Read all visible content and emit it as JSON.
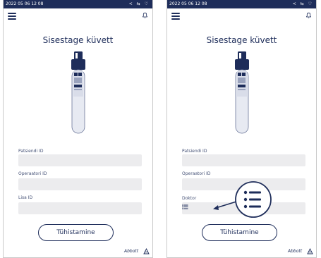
{
  "screens": [
    {
      "status_time": "2022 05 06 12 08",
      "status_icons": "< ⇆ ♡",
      "title": "Sisestage küvett",
      "fields": [
        {
          "label": "Patsiendi ID",
          "value": ""
        },
        {
          "label": "Operaatori ID",
          "value": ""
        },
        {
          "label": "Lisa ID",
          "value": ""
        }
      ],
      "cancel_label": "Tühistamine",
      "logo_text": "Abbott"
    },
    {
      "status_time": "2022 05 06 12 08",
      "status_icons": "< ⇆ ♡",
      "title": "Sisestage küvett",
      "fields": [
        {
          "label": "Patsiendi ID",
          "value": ""
        },
        {
          "label": "Operaatori ID",
          "value": ""
        },
        {
          "label": "Doktor",
          "value": ""
        }
      ],
      "cancel_label": "Tühistamine",
      "logo_text": "Abbott"
    }
  ],
  "icons": {
    "menu": "hamburger-menu-icon",
    "notification": "bell-icon",
    "list": "list-icon",
    "brand": "brand-mark-icon"
  },
  "colors": {
    "accent": "#1e2d5a",
    "input_bg": "#ececee",
    "border": "#c9c9c9"
  }
}
